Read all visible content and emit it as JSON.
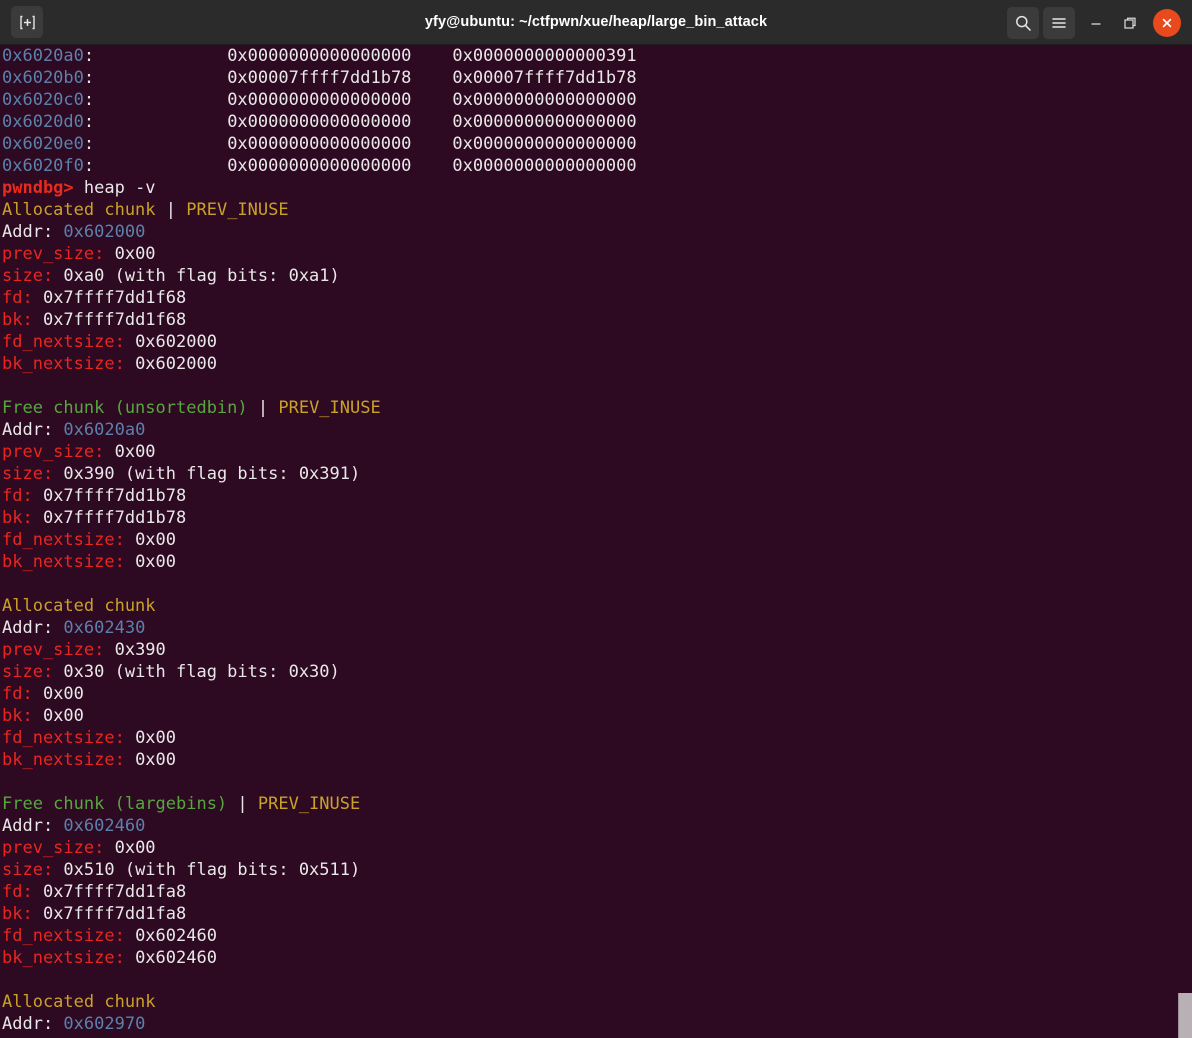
{
  "window": {
    "title": "yfy@ubuntu: ~/ctfpwn/xue/heap/large_bin_attack",
    "new_tab_icon": "new-tab-icon",
    "search_icon": "search-icon",
    "menu_icon": "hamburger-menu-icon",
    "minimize_icon": "minimize-icon",
    "maximize_icon": "maximize-icon",
    "close_icon": "close-icon",
    "colors": {
      "titlebar_bg": "#2b2b2b",
      "title_fg": "#ffffff",
      "close_bg": "#e8491d",
      "terminal_bg": "#2d0922",
      "fg_white": "#e8e8e8",
      "fg_blue": "#5c81ab",
      "fg_red": "#e8261f",
      "fg_yellow": "#c9a227",
      "fg_green": "#57a73e",
      "scrollbar": "#b8b0b5"
    }
  },
  "terminal": {
    "prompt": "pwndbg>",
    "command": "heap -v",
    "memory_dump": [
      {
        "addr": "0x6020a0:",
        "col1": "0x0000000000000000",
        "col2": "0x0000000000000391"
      },
      {
        "addr": "0x6020b0:",
        "col1": "0x00007ffff7dd1b78",
        "col2": "0x00007ffff7dd1b78"
      },
      {
        "addr": "0x6020c0:",
        "col1": "0x0000000000000000",
        "col2": "0x0000000000000000"
      },
      {
        "addr": "0x6020d0:",
        "col1": "0x0000000000000000",
        "col2": "0x0000000000000000"
      },
      {
        "addr": "0x6020e0:",
        "col1": "0x0000000000000000",
        "col2": "0x0000000000000000"
      },
      {
        "addr": "0x6020f0:",
        "col1": "0x0000000000000000",
        "col2": "0x0000000000000000"
      }
    ],
    "labels": {
      "addr": "Addr:",
      "prev_size": "prev_size:",
      "size": "size:",
      "fd": "fd:",
      "bk": "bk:",
      "fd_nextsize": "fd_nextsize:",
      "bk_nextsize": "bk_nextsize:",
      "flag_separator": "|",
      "flag_prev_inuse": "PREV_INUSE"
    },
    "chunks": [
      {
        "kind": "allocated",
        "header": "Allocated chunk",
        "flag": "PREV_INUSE",
        "addr": "0x602000",
        "prev_size": "0x00",
        "size": "0xa0 (with flag bits: 0xa1)",
        "fd": "0x7ffff7dd1f68",
        "bk": "0x7ffff7dd1f68",
        "fd_nextsize": "0x602000",
        "bk_nextsize": "0x602000"
      },
      {
        "kind": "free",
        "header": "Free chunk (unsortedbin)",
        "flag": "PREV_INUSE",
        "addr": "0x6020a0",
        "prev_size": "0x00",
        "size": "0x390 (with flag bits: 0x391)",
        "fd": "0x7ffff7dd1b78",
        "bk": "0x7ffff7dd1b78",
        "fd_nextsize": "0x00",
        "bk_nextsize": "0x00"
      },
      {
        "kind": "allocated",
        "header": "Allocated chunk",
        "flag": "",
        "addr": "0x602430",
        "prev_size": "0x390",
        "size": "0x30 (with flag bits: 0x30)",
        "fd": "0x00",
        "bk": "0x00",
        "fd_nextsize": "0x00",
        "bk_nextsize": "0x00"
      },
      {
        "kind": "free",
        "header": "Free chunk (largebins)",
        "flag": "PREV_INUSE",
        "addr": "0x602460",
        "prev_size": "0x00",
        "size": "0x510 (with flag bits: 0x511)",
        "fd": "0x7ffff7dd1fa8",
        "bk": "0x7ffff7dd1fa8",
        "fd_nextsize": "0x602460",
        "bk_nextsize": "0x602460"
      },
      {
        "kind": "allocated",
        "header": "Allocated chunk",
        "flag": "",
        "addr": "0x602970",
        "prev_size": "",
        "size": "",
        "fd": "",
        "bk": "",
        "fd_nextsize": "",
        "bk_nextsize": "",
        "truncated": true
      }
    ]
  }
}
